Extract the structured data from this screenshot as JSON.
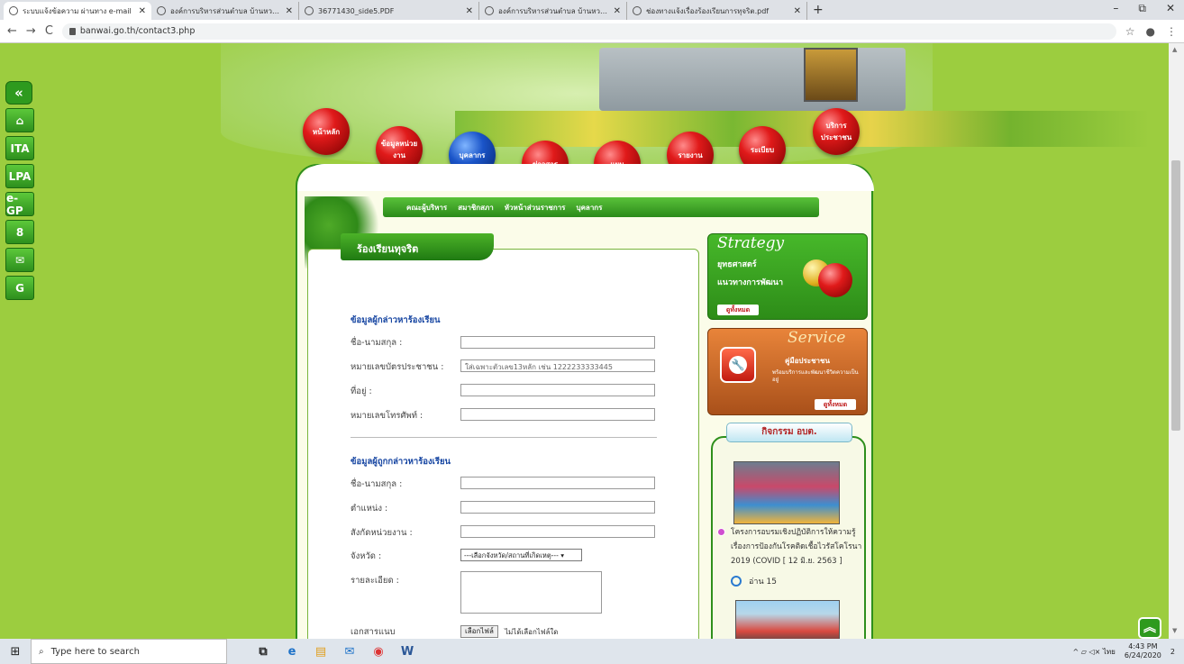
{
  "browser": {
    "tabs": [
      {
        "title": "ระบบแจ้งข้อความ ผ่านทาง e-mail",
        "active": true
      },
      {
        "title": "องค์การบริหารส่วนตำบล บ้านหวาย อ.",
        "active": false
      },
      {
        "title": "36771430_side5.PDF",
        "active": false
      },
      {
        "title": "องค์การบริหารส่วนตำบล บ้านหวาย อ.",
        "active": false
      },
      {
        "title": "ช่องทางแจ้งเรื่องร้องเรียนการทุจริต.pdf",
        "active": false
      }
    ],
    "new_tab": "+",
    "window_controls": {
      "minimize": "–",
      "restore": "⧉",
      "close": "✕"
    },
    "nav": {
      "back": "←",
      "forward": "→",
      "reload": "C"
    },
    "url": "banwai.go.th/contact3.php",
    "star": "☆",
    "profile": "●",
    "menu": "⋮"
  },
  "left_bar": {
    "back_glyph": "«",
    "home_glyph": "⌂",
    "items": [
      "ITA",
      "LPA",
      "e-GP"
    ],
    "user_glyph": "8",
    "mail_glyph": "✉",
    "translate_glyph": "G"
  },
  "main_menu": [
    "หน้าหลัก",
    "ข้อมูลหน่วยงาน",
    "บุคลากร",
    "ข่าวสาร",
    "แผน",
    "รายงาน",
    "ระเบียบ",
    "บริการประชาชน"
  ],
  "sub_menu": [
    "คณะผู้บริหาร",
    "สมาชิกสภา",
    "หัวหน้าส่วนราชการ",
    "บุคลากร"
  ],
  "content": {
    "title": "ร้องเรียนทุจริต",
    "section1": "ข้อมูลผู้กล่าวหาร้องเรียน",
    "fields1": [
      {
        "label": "ชื่อ-นามสกุล :",
        "placeholder": ""
      },
      {
        "label": "หมายเลขบัตรประชาชน :",
        "placeholder": "ใส่เฉพาะตัวเลข13หลัก เช่น 1222233333445"
      },
      {
        "label": "ที่อยู่ :",
        "placeholder": ""
      },
      {
        "label": "หมายเลขโทรศัพท์ :",
        "placeholder": ""
      }
    ],
    "section2": "ข้อมูลผู้ถูกกล่าวหาร้องเรียน",
    "fields2": [
      {
        "label": "ชื่อ-นามสกุล :",
        "placeholder": ""
      },
      {
        "label": "ตำแหน่ง :",
        "placeholder": ""
      },
      {
        "label": "สังกัดหน่วยงาน :",
        "placeholder": ""
      }
    ],
    "province_label": "จังหวัด :",
    "province_select": "---เลือกจังหวัด/สถานที่เกิดเหตุ--- ▾",
    "detail_label": "รายละเอียด :",
    "attach_label": "เอกสารแนบ",
    "file_button": "เลือกไฟล์",
    "file_status": "ไม่ได้เลือกไฟล์ใด"
  },
  "sidebar": {
    "strategy": {
      "title": "Strategy",
      "line1": "ยุทธศาสตร์",
      "line2": "แนวทางการพัฒนา",
      "button": "ดูทั้งหมด"
    },
    "service": {
      "title": "Service",
      "line1": "คู่มือประชาชน",
      "line2": "พร้อมบริการและพัฒนาชีวิตความเป็นอยู่",
      "button": "ดูทั้งหมด",
      "icon_glyph": "🔧"
    },
    "activity": {
      "header": "กิจกรรม อบต.",
      "item_text": "โครงการอบรมเชิงปฏิบัติการให้ความรู้เรื่องการป้องกันโรคติดเชื้อไวรัสโคโรนา 2019 (COVID [ 12 มิ.ย. 2563 ]",
      "reads": "อ่าน 15"
    }
  },
  "scroll_top_glyph": "︽",
  "taskbar": {
    "start_glyph": "⊞",
    "search_placeholder": "Type here to search",
    "search_glyph": "⌕",
    "apps": [
      "⧉",
      "e",
      "▤",
      "✉",
      "◉",
      "W"
    ],
    "tray": "^  ▱  ◁×  ไทย",
    "time": "4:43 PM",
    "date": "6/24/2020",
    "notification_count": "2"
  }
}
